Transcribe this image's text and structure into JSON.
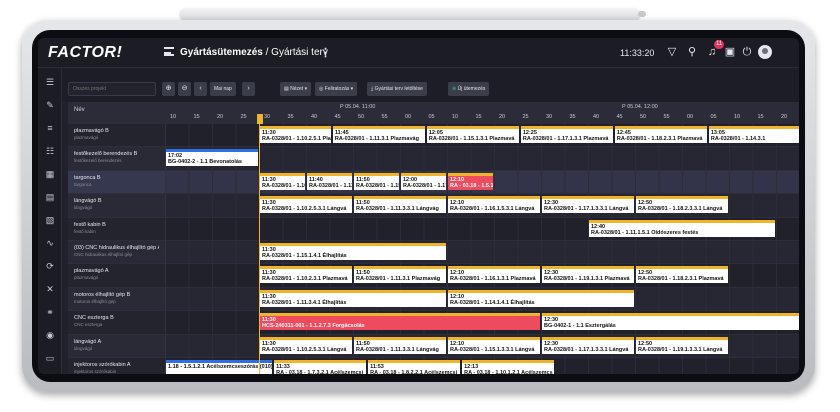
{
  "header": {
    "logo": "FACTOR!",
    "title_bold": "Gyártásütemezés",
    "title_rest": " / Gyártási terv",
    "clock": "11:33:20",
    "notification_count": "11",
    "icons": [
      "filter-icon",
      "search-icon",
      "bell-icon",
      "calendar-icon",
      "power-icon",
      "user-icon"
    ]
  },
  "toolbar": {
    "search_placeholder": "Összes projekt",
    "today_label": "Mai nap",
    "view_label": "Nézet",
    "text_label": "Feliratozás",
    "export_label": "Gyártási terv letöltése",
    "new_label": "Új ütemezés"
  },
  "grid": {
    "name_header": "Név",
    "major_ticks": [
      {
        "label": "P 05.04. 11:00",
        "col": 8
      },
      {
        "label": "P 05.04. 12:00",
        "col": 20
      }
    ],
    "minor_ticks": [
      "10",
      "15",
      "20",
      "25",
      "30",
      "35",
      "40",
      "45",
      "50",
      "55",
      "00",
      "05",
      "10",
      "15",
      "20",
      "25",
      "30",
      "35",
      "40",
      "45",
      "50",
      "55",
      "00",
      "05",
      "10",
      "15",
      "20",
      "25"
    ],
    "rows": [
      {
        "name": "plazmavágó B",
        "sub": "plazmavágó",
        "jobs": [
          {
            "time": "11:30",
            "desc": "RA-0328/01 - 1.10.2.5.1 Plazmavá",
            "start": 4,
            "len": 3.1
          },
          {
            "time": "11:45",
            "desc": "RA-0328/01 - 1.11.3.1 Plazmavág",
            "start": 7.1,
            "len": 4
          },
          {
            "time": "12:05",
            "desc": "RA-0328/01 - 1.15.1.3.1 Plazmavá",
            "start": 11.1,
            "len": 4
          },
          {
            "time": "12:25",
            "desc": "RA-0328/01 - 1.17.1.3.1 Plazmavá",
            "start": 15.1,
            "len": 4
          },
          {
            "time": "12:45",
            "desc": "RA-0328/01 - 1.18.2.3.1 Plazmavá",
            "start": 19.1,
            "len": 4
          },
          {
            "time": "13:05",
            "desc": "RA-0328/01 - 1.14.3.1",
            "start": 23.1,
            "len": 4
          }
        ]
      },
      {
        "name": "festőkezelő berendezés B",
        "sub": "festőkezelő berendezés",
        "jobs": [
          {
            "time": "17:02",
            "desc": "BG-0402-2 - 1.1 Bevonatolás",
            "start": 0,
            "len": 4,
            "style": "blue"
          }
        ]
      },
      {
        "name": "targonca B",
        "sub": "targonca",
        "selected": true,
        "jobs": [
          {
            "time": "11:30",
            "desc": "RA-0328/01 - 1.10.2",
            "start": 4,
            "len": 2
          },
          {
            "time": "11:40",
            "desc": "RA-0328/01 - 1.11.3",
            "start": 6,
            "len": 2
          },
          {
            "time": "11:50",
            "desc": "RA-0328/01 - 1.15.1",
            "start": 8,
            "len": 2
          },
          {
            "time": "12:00",
            "desc": "RA-0328/01 - 1.17.1",
            "start": 10,
            "len": 2
          },
          {
            "time": "12:10",
            "desc": "RA - 03.18 - 1.5.1.",
            "start": 12,
            "len": 2,
            "style": "red"
          }
        ]
      },
      {
        "name": "lángvágó B",
        "sub": "lángvágó",
        "jobs": [
          {
            "time": "11:30",
            "desc": "RA-0328/01 - 1.10.2.5.3.1 Lángvá",
            "start": 4,
            "len": 4
          },
          {
            "time": "11:50",
            "desc": "RA-0328/01 - 1.11.3.3.1 Lángvág",
            "start": 8,
            "len": 4
          },
          {
            "time": "12:10",
            "desc": "RA-0328/01 - 1.16.1.5.3.1 Lángvá",
            "start": 12,
            "len": 4
          },
          {
            "time": "12:30",
            "desc": "RA-0328/01 - 1.17.1.3.3.1 Lángvá",
            "start": 16,
            "len": 4
          },
          {
            "time": "12:50",
            "desc": "RA-0328/01 - 1.18.2.3.3.1 Lángvá",
            "start": 20,
            "len": 4
          }
        ]
      },
      {
        "name": "festő kabin B",
        "sub": "festő kabin",
        "jobs": [
          {
            "time": "12:40",
            "desc": "RA-0328/01 - 1.11.1.5.1 Oldószeres festés",
            "start": 18,
            "len": 8
          }
        ]
      },
      {
        "name": "(03) CNC hidraulikus élhajlító gép A",
        "sub": "CNC hidraulikus élhajlító gép",
        "jobs": [
          {
            "time": "11:30",
            "desc": "RA-0328/01 - 1.15.1.4.1 Élhajlítás",
            "start": 4,
            "len": 8
          }
        ]
      },
      {
        "name": "plazmavágó A",
        "sub": "plazmavágó",
        "jobs": [
          {
            "time": "11:30",
            "desc": "RA-0328/01 - 1.10.2.3.1 Plazmavá",
            "start": 4,
            "len": 4
          },
          {
            "time": "11:50",
            "desc": "RA-0328/01 - 1.11.3.1 Plazmavág",
            "start": 8,
            "len": 4
          },
          {
            "time": "12:10",
            "desc": "RA-0328/01 - 1.16.1.3.1 Plazmavá",
            "start": 12,
            "len": 4
          },
          {
            "time": "12:30",
            "desc": "RA-0328/01 - 1.19.1.3.1 Plazmavá",
            "start": 16,
            "len": 4
          },
          {
            "time": "12:50",
            "desc": "RA-0328/01 - 1.18.2.3.1 Plazmavá",
            "start": 20,
            "len": 4
          }
        ]
      },
      {
        "name": "motoros élhajlító gép B",
        "sub": "motoros élhajlító gép",
        "jobs": [
          {
            "time": "11:30",
            "desc": "RA-0328/01 - 1.11.3.4.1 Élhajlítás",
            "start": 4,
            "len": 8
          },
          {
            "time": "12:10",
            "desc": "RA-0328/01 - 1.14.1.4.1 Élhajlítás",
            "start": 12,
            "len": 8
          }
        ]
      },
      {
        "name": "CNC esztergа B",
        "sub": "CNC esztergа",
        "jobs": [
          {
            "time": "11:30",
            "desc": "HCS-240311-001 - 1.1.2.7.3 Forgácsolás",
            "start": 4,
            "len": 12,
            "style": "red"
          },
          {
            "time": "12:30",
            "desc": "BG-0402-1 - 1.1 Esztergálás",
            "start": 16,
            "len": 11
          }
        ]
      },
      {
        "name": "lángvágó A",
        "sub": "lángvágó",
        "jobs": [
          {
            "time": "11:30",
            "desc": "RA-0328/01 - 1.10.2.5.3.1 Lángvá",
            "start": 4,
            "len": 4
          },
          {
            "time": "11:50",
            "desc": "RA-0328/01 - 1.11.3.3.1 Lángvág",
            "start": 8,
            "len": 4
          },
          {
            "time": "12:10",
            "desc": "RA-0328/01 - 1.15.1.3.3.1 Lángvá",
            "start": 12,
            "len": 4
          },
          {
            "time": "12:30",
            "desc": "RA-0328/01 - 1.17.1.3.3.1 Lángvá",
            "start": 16,
            "len": 4
          },
          {
            "time": "12:50",
            "desc": "RA-0328/01 - 1.19.1.3.3.1 Lángvá",
            "start": 20,
            "len": 4
          }
        ]
      },
      {
        "name": "injektoros szórókabin A",
        "sub": "injektoros szórókabin",
        "jobs": [
          {
            "time": "",
            "desc": "1.18 - 1.5.1.2.1 Acélszemcseszórás (010)",
            "start": 0,
            "len": 4.6,
            "style": "blue"
          },
          {
            "time": "11:33",
            "desc": "RA - 03.18 - 1.7.3.2.1 Acélszemcsi",
            "start": 4.6,
            "len": 4
          },
          {
            "time": "11:53",
            "desc": "RA - 03.18 - 1.8.2.2.1 Acélszemcsi",
            "start": 8.6,
            "len": 4
          },
          {
            "time": "12:13",
            "desc": "RA - 03.18 - 1.10.1.2.1 Acélszemcs",
            "start": 12.6,
            "len": 4
          }
        ]
      }
    ]
  }
}
